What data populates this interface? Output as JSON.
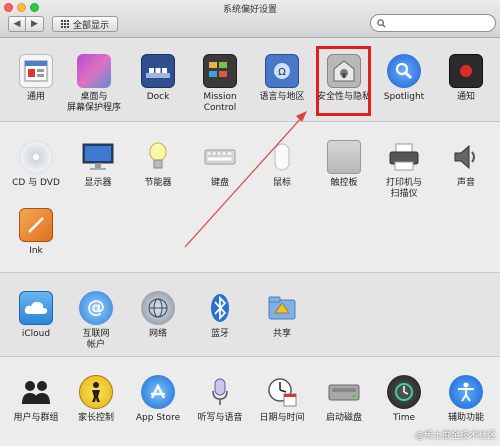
{
  "window": {
    "title": "系统偏好设置",
    "show_all": "全部显示",
    "search_placeholder": "",
    "back": "◀",
    "forward": "▶"
  },
  "sections": {
    "personal": [
      {
        "label": "通用",
        "icon": "general-icon"
      },
      {
        "label": "桌面与\n屏幕保护程序",
        "icon": "desktop-screensaver-icon"
      },
      {
        "label": "Dock",
        "icon": "dock-icon"
      },
      {
        "label": "Mission\nControl",
        "icon": "mission-control-icon"
      },
      {
        "label": "语言与地区",
        "icon": "language-region-icon"
      },
      {
        "label": "安全性与隐私",
        "icon": "security-privacy-icon"
      },
      {
        "label": "Spotlight",
        "icon": "spotlight-icon"
      },
      {
        "label": "通知",
        "icon": "notifications-icon"
      }
    ],
    "hardware": [
      {
        "label": "CD 与 DVD",
        "icon": "cd-dvd-icon"
      },
      {
        "label": "显示器",
        "icon": "displays-icon"
      },
      {
        "label": "节能器",
        "icon": "energy-saver-icon"
      },
      {
        "label": "键盘",
        "icon": "keyboard-icon"
      },
      {
        "label": "鼠标",
        "icon": "mouse-icon"
      },
      {
        "label": "触控板",
        "icon": "trackpad-icon"
      },
      {
        "label": "打印机与\n扫描仪",
        "icon": "printer-scanner-icon"
      },
      {
        "label": "声音",
        "icon": "sound-icon"
      },
      {
        "label": "Ink",
        "icon": "ink-icon"
      }
    ],
    "internet": [
      {
        "label": "iCloud",
        "icon": "icloud-icon"
      },
      {
        "label": "互联网\n帐户",
        "icon": "internet-accounts-icon"
      },
      {
        "label": "网络",
        "icon": "network-icon"
      },
      {
        "label": "蓝牙",
        "icon": "bluetooth-icon"
      },
      {
        "label": "共享",
        "icon": "sharing-icon"
      }
    ],
    "system": [
      {
        "label": "用户与群组",
        "icon": "users-groups-icon"
      },
      {
        "label": "家长控制",
        "icon": "parental-controls-icon"
      },
      {
        "label": "App Store",
        "icon": "app-store-icon"
      },
      {
        "label": "听写与语音",
        "icon": "dictation-speech-icon"
      },
      {
        "label": "日期与时间",
        "icon": "date-time-icon"
      },
      {
        "label": "启动磁盘",
        "icon": "startup-disk-icon"
      },
      {
        "label": "Time",
        "icon": "time-machine-icon"
      },
      {
        "label": "辅助功能",
        "icon": "accessibility-icon"
      }
    ]
  },
  "watermark": "@稀土掘金技术社区",
  "colors": {
    "highlight": "#e02020",
    "arrow": "#e04040"
  }
}
